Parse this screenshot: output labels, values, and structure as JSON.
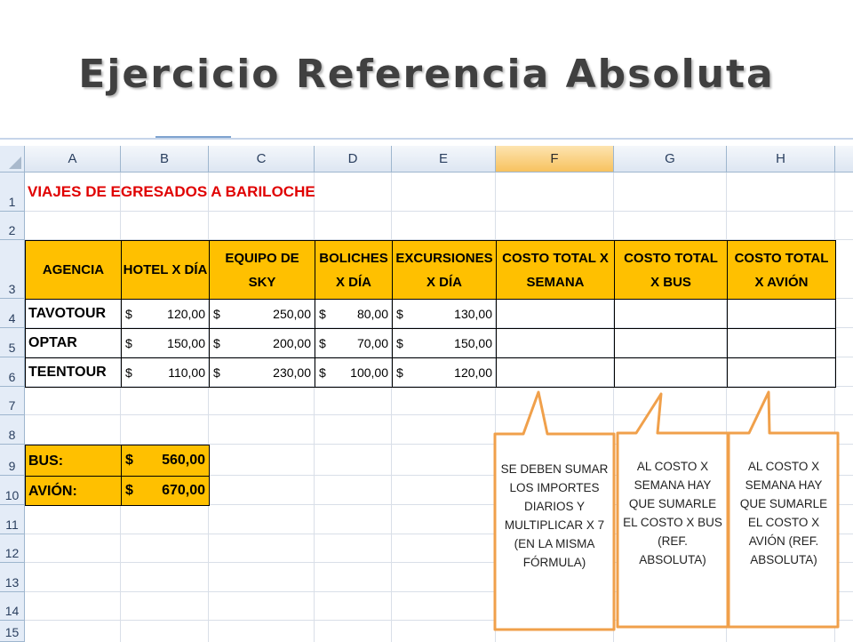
{
  "slide": {
    "title": "Ejercicio Referencia Absoluta"
  },
  "sheet": {
    "columns": [
      "A",
      "B",
      "C",
      "D",
      "E",
      "F",
      "G",
      "H"
    ],
    "rows": [
      "1",
      "2",
      "3",
      "4",
      "5",
      "6",
      "7",
      "8",
      "9",
      "10",
      "11",
      "12",
      "13",
      "14",
      "15"
    ],
    "selected_column": "F",
    "title": "VIAJES DE EGRESADOS A BARILOCHE",
    "headers": {
      "agency": "AGENCIA",
      "hotel": "HOTEL X DÍA",
      "ski": "EQUIPO DE SKY",
      "boliches": "BOLICHES X DÍA",
      "excursiones": "EXCURSIONES X DÍA",
      "week": "COSTO TOTAL X SEMANA",
      "bus": "COSTO TOTAL X BUS",
      "plane": "COSTO TOTAL X AVIÓN"
    },
    "currency": "$",
    "data": [
      {
        "agency": "TAVOTOUR",
        "hotel": "120,00",
        "ski": "250,00",
        "boliches": "80,00",
        "excursiones": "130,00"
      },
      {
        "agency": "OPTAR",
        "hotel": "150,00",
        "ski": "200,00",
        "boliches": "70,00",
        "excursiones": "150,00"
      },
      {
        "agency": "TEENTOUR",
        "hotel": "110,00",
        "ski": "230,00",
        "boliches": "100,00",
        "excursiones": "120,00"
      }
    ],
    "bus_label": "BUS:",
    "bus_value": "560,00",
    "plane_label": "AVIÓN:",
    "plane_value": "670,00"
  },
  "callouts": [
    {
      "text": "SE DEBEN SUMAR\nLOS IMPORTES\nDIARIOS Y\nMULTIPLICAR X 7\n(EN LA MISMA\nFÓRMULA)"
    },
    {
      "text": "AL COSTO X\nSEMANA HAY\nQUE SUMARLE\nEL COSTO X BUS\n(REF.\nABSOLUTA)"
    },
    {
      "text": "AL COSTO X\nSEMANA HAY\nQUE SUMARLE\nEL COSTO X\nAVIÓN (REF.\nABSOLUTA)"
    }
  ],
  "colors": {
    "header_fill": "#ffc000",
    "title_text": "#e00000",
    "callout_border": "#f0a04b"
  }
}
